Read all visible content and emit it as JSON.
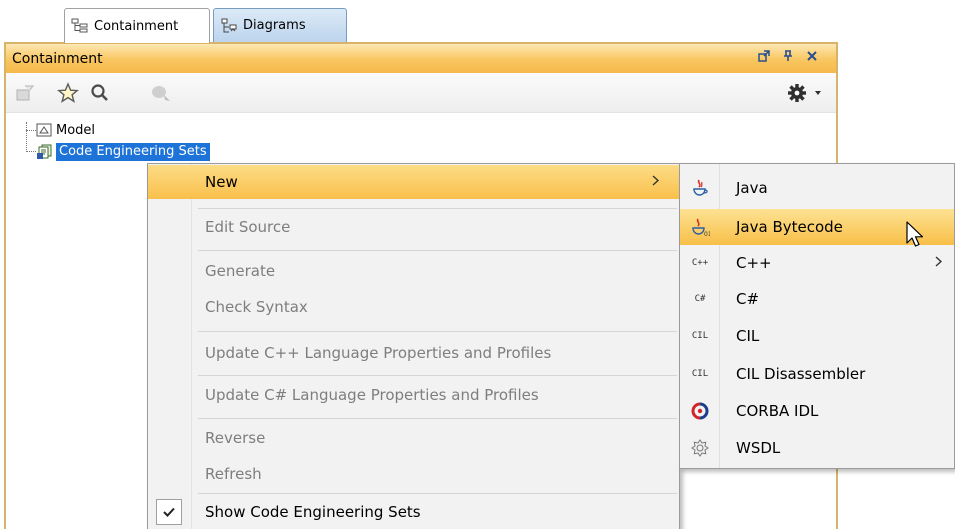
{
  "tabs": [
    {
      "label": "Containment",
      "icon": "containment-tree-icon"
    },
    {
      "label": "Diagrams",
      "icon": "diagrams-tree-icon"
    }
  ],
  "panel": {
    "title": "Containment",
    "controls": [
      "undock-icon",
      "pin-icon",
      "close-icon"
    ]
  },
  "toolbar": {
    "buttons": [
      "open-specification-icon",
      "favorite-star-icon",
      "search-icon",
      "filter-icon",
      "settings-gear-icon"
    ]
  },
  "tree": {
    "items": [
      {
        "label": "Model",
        "icon": "model-package-icon"
      },
      {
        "label": "Code Engineering Sets",
        "icon": "code-engineering-sets-icon"
      }
    ]
  },
  "context_menu": {
    "items": [
      {
        "label": "New",
        "enabled": true,
        "highlighted": true,
        "submenu": true
      },
      {
        "label": "Edit Source",
        "enabled": false
      },
      {
        "label": "Generate",
        "enabled": false
      },
      {
        "label": "Check Syntax",
        "enabled": false
      },
      {
        "label": "Update C++ Language Properties and Profiles",
        "enabled": false
      },
      {
        "label": "Update C# Language Properties and Profiles",
        "enabled": false
      },
      {
        "label": "Reverse",
        "enabled": false
      },
      {
        "label": "Refresh",
        "enabled": false
      },
      {
        "label": "Show Code Engineering Sets",
        "enabled": true,
        "checked": true
      }
    ]
  },
  "submenu": {
    "items": [
      {
        "label": "Java",
        "icon": "java-icon"
      },
      {
        "label": "Java Bytecode",
        "icon": "java-bytecode-icon",
        "highlighted": true
      },
      {
        "label": "C++",
        "icon": "cpp-icon",
        "icon_text": "C++",
        "submenu": true
      },
      {
        "label": "C#",
        "icon": "csharp-icon",
        "icon_text": "C#"
      },
      {
        "label": "CIL",
        "icon": "cil-icon",
        "icon_text": "CIL"
      },
      {
        "label": "CIL Disassembler",
        "icon": "cil-disassembler-icon",
        "icon_text": "CIL"
      },
      {
        "label": "CORBA IDL",
        "icon": "corba-idl-icon"
      },
      {
        "label": "WSDL",
        "icon": "wsdl-icon"
      }
    ]
  },
  "colors": {
    "panel_title": "#f9c660",
    "highlight": "#f9c04c",
    "selection": "#1e73d8",
    "disabled_text": "#7e7e7e"
  }
}
